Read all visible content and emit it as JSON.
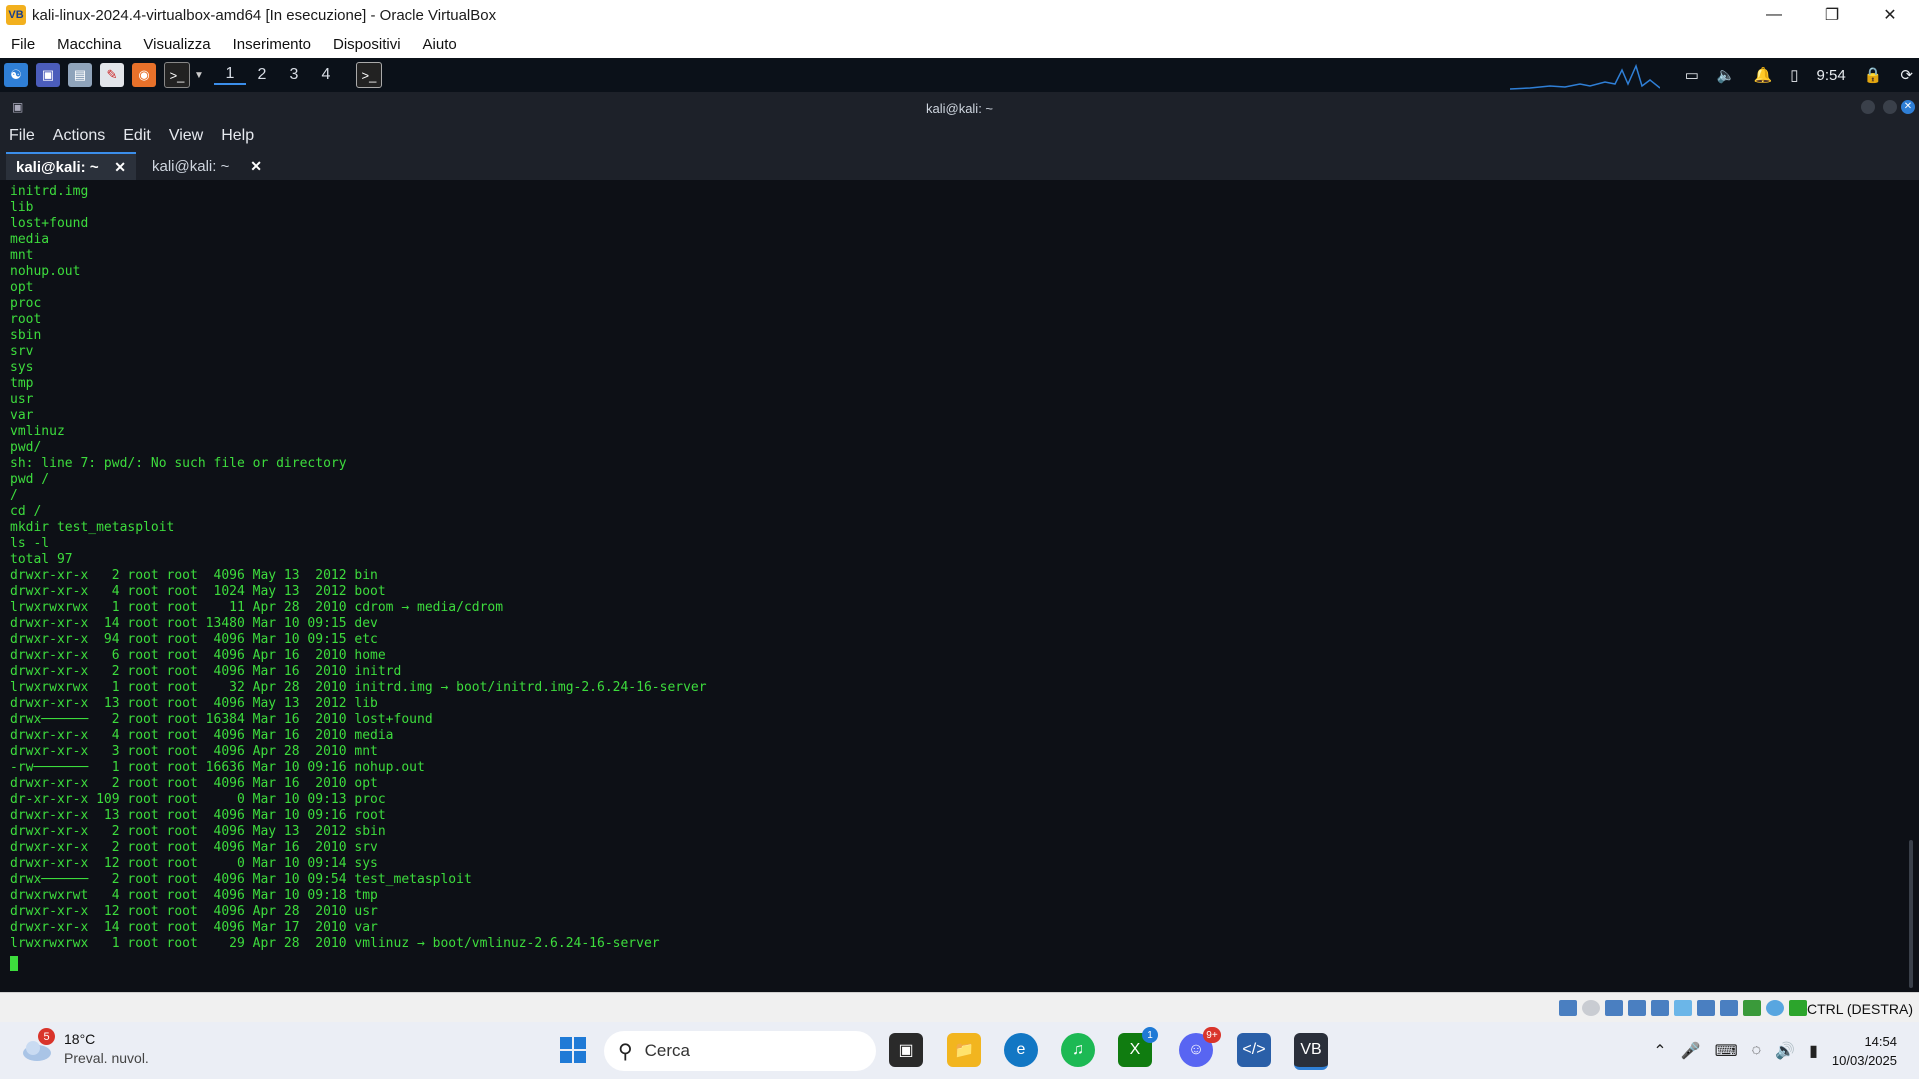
{
  "vbox": {
    "title": "kali-linux-2024.4-virtualbox-amd64 [In esecuzione] - Oracle VirtualBox",
    "menu": [
      "File",
      "Macchina",
      "Visualizza",
      "Inserimento",
      "Dispositivi",
      "Aiuto"
    ],
    "host_key": "CTRL (DESTRA)"
  },
  "kali_panel": {
    "workspaces": [
      "1",
      "2",
      "3",
      "4"
    ],
    "active_workspace": "1",
    "clock": "9:54"
  },
  "terminal": {
    "window_title": "kali@kali: ~",
    "menu": [
      "File",
      "Actions",
      "Edit",
      "View",
      "Help"
    ],
    "tabs": [
      {
        "label": "kali@kali: ~",
        "active": true
      },
      {
        "label": "kali@kali: ~",
        "active": false
      }
    ],
    "lines": [
      "initrd.img",
      "lib",
      "lost+found",
      "media",
      "mnt",
      "nohup.out",
      "opt",
      "proc",
      "root",
      "sbin",
      "srv",
      "sys",
      "tmp",
      "usr",
      "var",
      "vmlinuz",
      "pwd/",
      "sh: line 7: pwd/: No such file or directory",
      "pwd /",
      "/",
      "cd /",
      "mkdir test_metasploit",
      "ls -l",
      "total 97",
      "drwxr-xr-x   2 root root  4096 May 13  2012 bin",
      "drwxr-xr-x   4 root root  1024 May 13  2012 boot",
      "lrwxrwxrwx   1 root root    11 Apr 28  2010 cdrom → media/cdrom",
      "drwxr-xr-x  14 root root 13480 Mar 10 09:15 dev",
      "drwxr-xr-x  94 root root  4096 Mar 10 09:15 etc",
      "drwxr-xr-x   6 root root  4096 Apr 16  2010 home",
      "drwxr-xr-x   2 root root  4096 Mar 16  2010 initrd",
      "lrwxrwxrwx   1 root root    32 Apr 28  2010 initrd.img → boot/initrd.img-2.6.24-16-server",
      "drwxr-xr-x  13 root root  4096 May 13  2012 lib",
      "drwx──────   2 root root 16384 Mar 16  2010 lost+found",
      "drwxr-xr-x   4 root root  4096 Mar 16  2010 media",
      "drwxr-xr-x   3 root root  4096 Apr 28  2010 mnt",
      "-rw───────   1 root root 16636 Mar 10 09:16 nohup.out",
      "drwxr-xr-x   2 root root  4096 Mar 16  2010 opt",
      "dr-xr-xr-x 109 root root     0 Mar 10 09:13 proc",
      "drwxr-xr-x  13 root root  4096 Mar 10 09:16 root",
      "drwxr-xr-x   2 root root  4096 May 13  2012 sbin",
      "drwxr-xr-x   2 root root  4096 Mar 16  2010 srv",
      "drwxr-xr-x  12 root root     0 Mar 10 09:14 sys",
      "drwx──────   2 root root  4096 Mar 10 09:54 test_metasploit",
      "drwxrwxrwt   4 root root  4096 Mar 10 09:18 tmp",
      "drwxr-xr-x  12 root root  4096 Apr 28  2010 usr",
      "drwxr-xr-x  14 root root  4096 Mar 17  2010 var",
      "lrwxrwxrwx   1 root root    29 Apr 28  2010 vmlinuz → boot/vmlinuz-2.6.24-16-server"
    ]
  },
  "taskbar": {
    "weather_temp": "18°C",
    "weather_desc": "Preval. nuvol.",
    "weather_badge": "5",
    "search_placeholder": "Cerca",
    "xbox_badge": "1",
    "discord_badge": "9+",
    "time": "14:54",
    "date": "10/03/2025"
  },
  "colors": {
    "terminal_text": "#3ddc3d",
    "terminal_bg": "#0d1016",
    "accent": "#3b8eea"
  }
}
